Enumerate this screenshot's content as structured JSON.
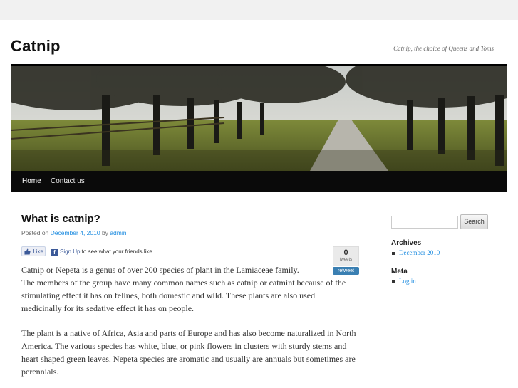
{
  "site": {
    "title": "Catnip",
    "tagline": "Catnip, the choice of Queens and Toms"
  },
  "nav": {
    "items": [
      {
        "label": "Home"
      },
      {
        "label": "Contact us"
      }
    ]
  },
  "post": {
    "title": "What is catnip?",
    "meta": {
      "posted_on": "Posted on",
      "date": "December 4, 2010",
      "by": "by",
      "author": "admin"
    },
    "social": {
      "like_label": "Like",
      "signup_link": "Sign Up",
      "signup_text": "to see what your friends like.",
      "tweet_count": "0",
      "tweet_label": "tweets",
      "retweet_label": "retweet"
    },
    "paragraphs": [
      "Catnip or Nepeta is a genus of over 200 species of plant in the Lamiaceae family.",
      "The members of the group have many common names such as catnip or catmint because of the stimulating effect it has on felines, both domestic and wild. These plants are also used medicinally for its sedative effect it has on people.",
      "The plant is a native of Africa, Asia and parts of Europe and has also become naturalized in North America. The various species has white, blue, or pink flowers in clusters with sturdy stems and heart shaped green leaves. Nepeta species are aromatic and usually are annuals but sometimes are perennials."
    ]
  },
  "sidebar": {
    "search": {
      "placeholder": "",
      "button_label": "Search"
    },
    "archives": {
      "title": "Archives",
      "items": [
        "December 2010"
      ]
    },
    "meta": {
      "title": "Meta",
      "items": [
        "Log in"
      ]
    }
  },
  "colors": {
    "link": "#1b8be0",
    "nav_bg": "#0a0a0a",
    "page_bg": "#f1f1f1"
  }
}
